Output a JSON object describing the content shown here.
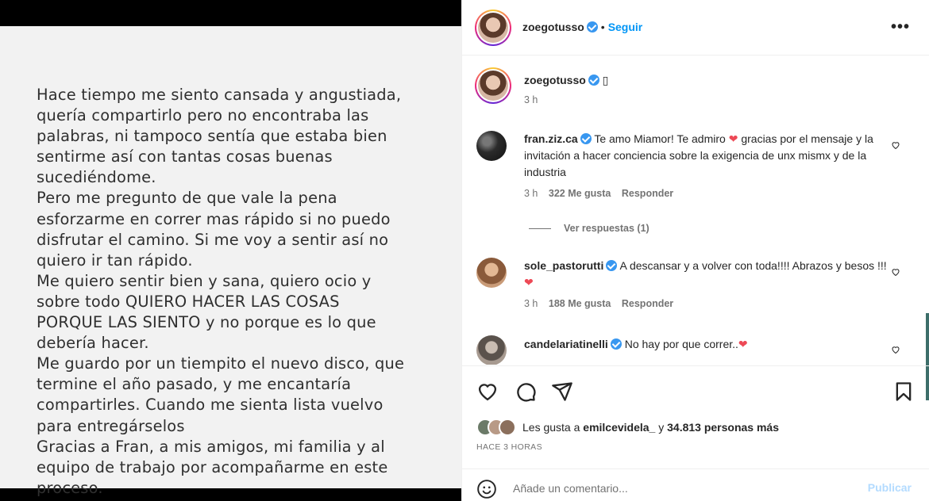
{
  "post_note": {
    "lines": [
      "Hace tiempo me siento cansada y angustiada,",
      "quería compartirlo pero no encontraba las",
      "palabras, ni tampoco sentía que estaba bien",
      "sentirme así con tantas cosas buenas",
      "sucediéndome.",
      "Pero me pregunto de que vale la pena",
      "esforzarme en correr mas rápido si no puedo",
      "disfrutar el camino. Si me voy a sentir así no",
      "quiero ir tan rápido.",
      "Me quiero sentir bien y sana, quiero ocio y",
      "sobre todo QUIERO HACER LAS COSAS",
      "PORQUE LAS SIENTO y no porque es lo que",
      "debería hacer.",
      "Me guardo por un tiempito el nuevo disco, que",
      "termine el año pasado, y me encantaría",
      "compartirles. Cuando me sienta lista vuelvo",
      "para entregárselos",
      "Gracias a Fran, a mis amigos, mi familia y al",
      "equipo de trabajo por acompañarme en este",
      "proceso."
    ]
  },
  "header": {
    "username": "zoegotusso",
    "separator": "•",
    "follow_label": "Seguir",
    "more_icon": "more-horizontal-icon"
  },
  "caption": {
    "username": "zoegotusso",
    "text": "▯",
    "time": "3 h"
  },
  "comments": [
    {
      "username": "fran.ziz.ca",
      "text_before_heart": "Te amo Miamor! Te admiro",
      "text_after_heart": "gracias por el mensaje y la invitación a hacer conciencia sobre la exigencia de unx mismx y de la industria",
      "time": "3 h",
      "likes": "322 Me gusta",
      "reply": "Responder",
      "avatar_color": "#2b2b2b"
    },
    {
      "username": "sole_pastorutti",
      "text_before_heart": "A descansar y a volver con toda!!!! Abrazos y besos !!!",
      "text_after_heart": "",
      "time": "3 h",
      "likes": "188 Me gusta",
      "reply": "Responder",
      "avatar_color": "#b07a5a"
    },
    {
      "username": "candelariatinelli",
      "text_before_heart": "No hay por que correr..",
      "text_after_heart": "",
      "avatar_color": "#8a8078"
    }
  ],
  "view_replies": "Ver respuestas (1)",
  "likes_summary": {
    "prefix": "Les gusta a",
    "user": "emilcevidela_",
    "middle": "y",
    "count": "34.813 personas más"
  },
  "posted_ago": "HACE 3 HORAS",
  "add_comment": {
    "placeholder": "Añade un comentario...",
    "publish_label": "Publicar"
  },
  "colors": {
    "accent": "#0095f6",
    "heart": "#ed4956",
    "verified": "#3897f0"
  }
}
